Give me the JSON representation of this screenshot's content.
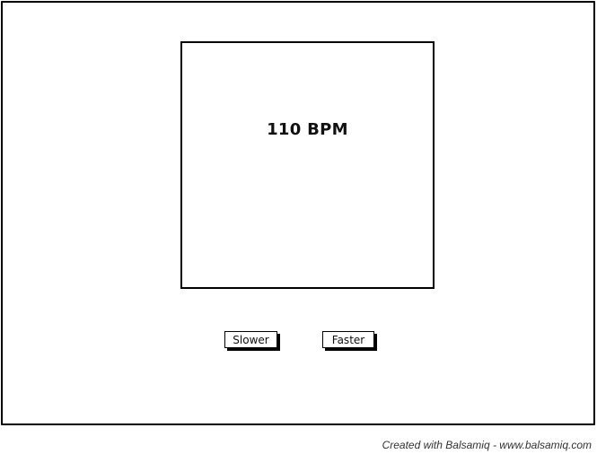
{
  "metronome": {
    "bpm_display": "110 BPM"
  },
  "controls": {
    "slower_label": "Slower",
    "faster_label": "Faster"
  },
  "footer": {
    "credit": "Created with Balsamiq - www.balsamiq.com"
  }
}
